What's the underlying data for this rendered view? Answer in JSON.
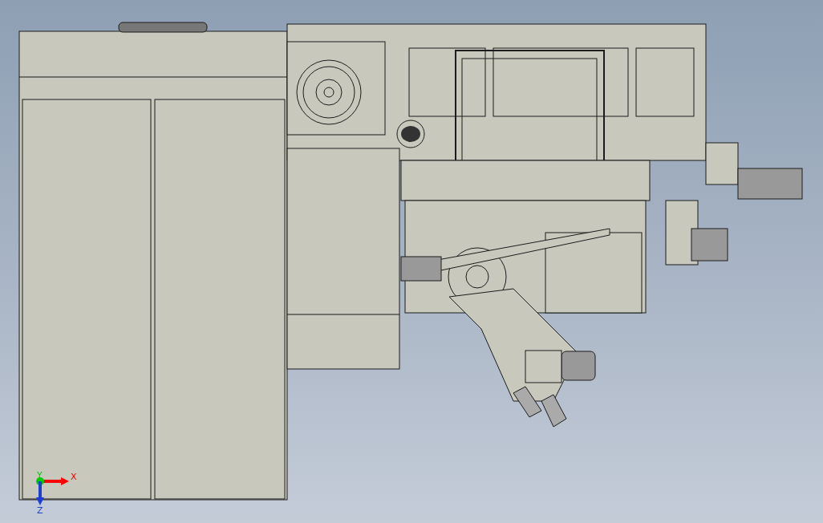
{
  "viewport": {
    "triad": {
      "axes": [
        {
          "kind": "x",
          "label": "X",
          "color": "#ff0000"
        },
        {
          "kind": "y",
          "label": "Y",
          "color": "#00cc00"
        },
        {
          "kind": "z",
          "label": "Z",
          "color": "#1a3fd6"
        }
      ]
    }
  }
}
